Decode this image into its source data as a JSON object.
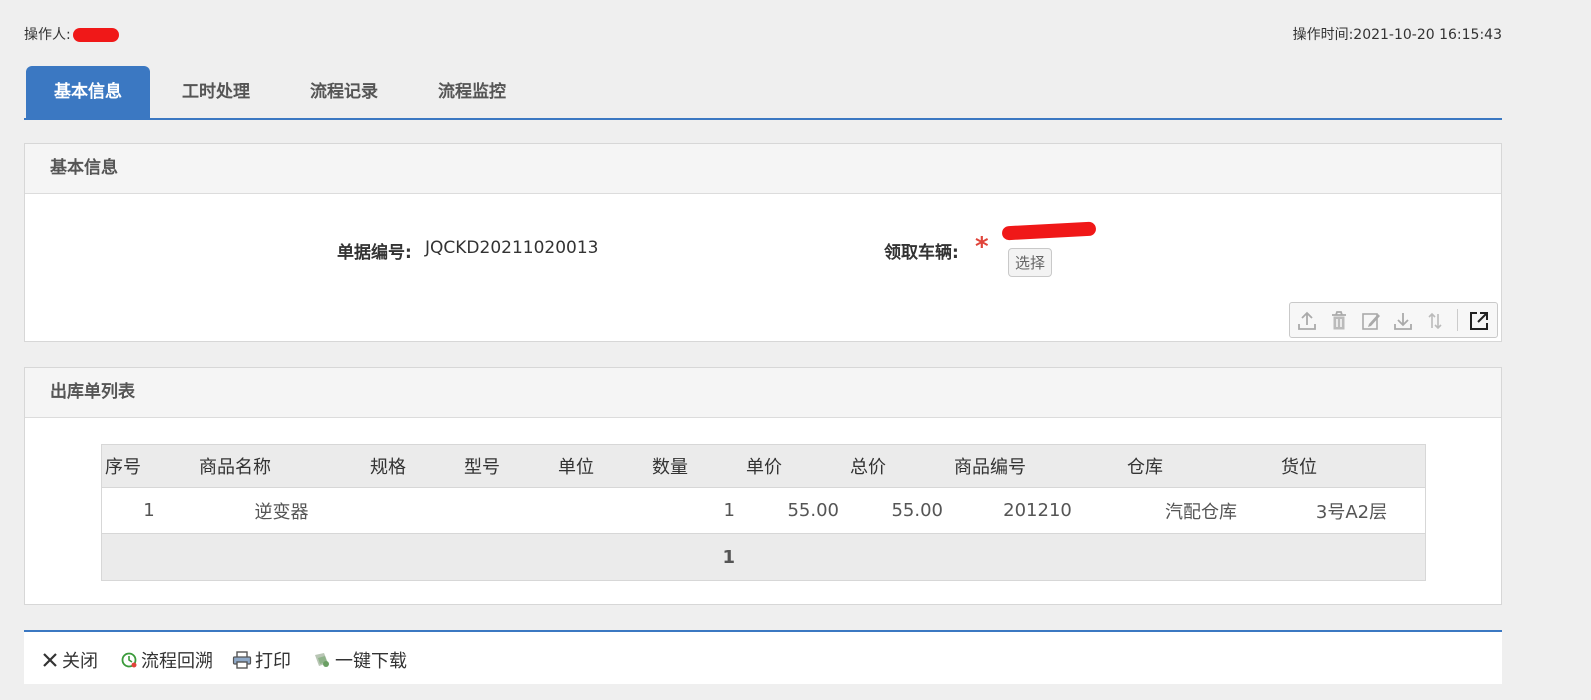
{
  "header": {
    "operator_label": "操作人:",
    "operator_time_label": "操作时间:",
    "operator_time_value": "2021-10-20 16:15:43"
  },
  "tabs": [
    {
      "label": "基本信息",
      "active": true
    },
    {
      "label": "工时处理",
      "active": false
    },
    {
      "label": "流程记录",
      "active": false
    },
    {
      "label": "流程监控",
      "active": false
    }
  ],
  "basic_panel": {
    "title": "基本信息",
    "doc_no_label": "单据编号:",
    "doc_no_value": "JQCKD20211020013",
    "vehicle_label": "领取车辆:",
    "required_mark": "*",
    "select_button": "选择",
    "toolbar_icons": [
      "upload-icon",
      "delete-icon",
      "edit-icon",
      "download-icon",
      "sort-icon",
      "external-link-icon"
    ]
  },
  "list_panel": {
    "title": "出库单列表",
    "columns": [
      "序号",
      "商品名称",
      "规格",
      "型号",
      "单位",
      "数量",
      "单价",
      "总价",
      "商品编号",
      "仓库",
      "货位"
    ],
    "rows": [
      {
        "index": "1",
        "name": "逆变器",
        "spec": "",
        "model": "",
        "unit": "",
        "qty": "1",
        "price": "55.00",
        "total": "55.00",
        "code": "201210",
        "warehouse": "汽配仓库",
        "location": "3号A2层"
      }
    ],
    "footer_qty": "1"
  },
  "bottom_bar": {
    "close": "关闭",
    "rollback": "流程回溯",
    "print": "打印",
    "download_all": "一键下载"
  },
  "colors": {
    "accent": "#3b78c2",
    "required": "#e0443a",
    "redaction": "#f01818"
  }
}
